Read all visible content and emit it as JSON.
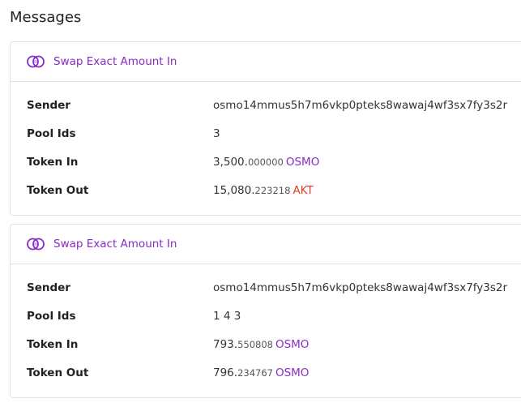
{
  "page": {
    "title": "Messages"
  },
  "messages": [
    {
      "type": "Swap Exact Amount In",
      "fields": {
        "sender_label": "Sender",
        "sender": "osmo14mmus5h7m6vkp0pteks8wawaj4wf3sx7fy3s2r",
        "pool_ids_label": "Pool Ids",
        "pool_ids": "3",
        "token_in_label": "Token In",
        "token_in_int": "3,500.",
        "token_in_dec": "000000",
        "token_in_denom": "OSMO",
        "token_out_label": "Token Out",
        "token_out_int": "15,080.",
        "token_out_dec": "223218",
        "token_out_denom": "AKT"
      }
    },
    {
      "type": "Swap Exact Amount In",
      "fields": {
        "sender_label": "Sender",
        "sender": "osmo14mmus5h7m6vkp0pteks8wawaj4wf3sx7fy3s2r",
        "pool_ids_label": "Pool Ids",
        "pool_ids": "1 4 3",
        "token_in_label": "Token In",
        "token_in_int": "793.",
        "token_in_dec": "550808",
        "token_in_denom": "OSMO",
        "token_out_label": "Token Out",
        "token_out_int": "796.",
        "token_out_dec": "234767",
        "token_out_denom": "OSMO"
      }
    }
  ],
  "colors": {
    "accent_purple": "#8a2bc5",
    "link_blue": "#3a6fd1",
    "akt_red": "#e23b2e"
  },
  "icons": {
    "message_type": "swap-rings-icon"
  }
}
